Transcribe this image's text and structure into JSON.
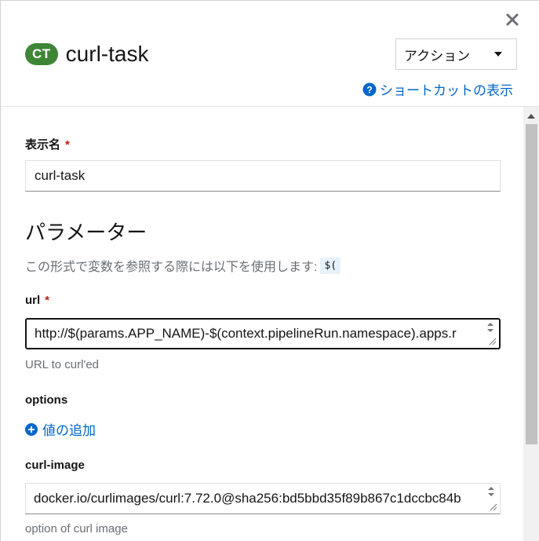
{
  "header": {
    "badge": "CT",
    "title": "curl-task",
    "action_label": "アクション",
    "shortcut_label": "ショートカットの表示"
  },
  "form": {
    "display_name_label": "表示名",
    "required_mark": "*",
    "display_name_value": "curl-task",
    "params_title": "パラメーター",
    "params_help": "この形式で変数を参照する際には以下を使用します:",
    "params_code": "$(",
    "url_label": "url",
    "url_value": "http://$(params.APP_NAME)-$(context.pipelineRun.namespace).apps.r",
    "url_helper": "URL to curl'ed",
    "options_label": "options",
    "add_value_label": "値の追加",
    "curl_image_label": "curl-image",
    "curl_image_value": "docker.io/curlimages/curl:7.72.0@sha256:bd5bbd35f89b867c1dccbc84b",
    "curl_image_helper": "option of curl image"
  },
  "colors": {
    "badge_bg": "#3e8635",
    "link": "#0066cc",
    "required": "#c9190b"
  },
  "icons": {
    "close": "close-icon",
    "caret": "caret-down-icon",
    "help": "question-circle-icon",
    "add": "plus-circle-icon"
  }
}
